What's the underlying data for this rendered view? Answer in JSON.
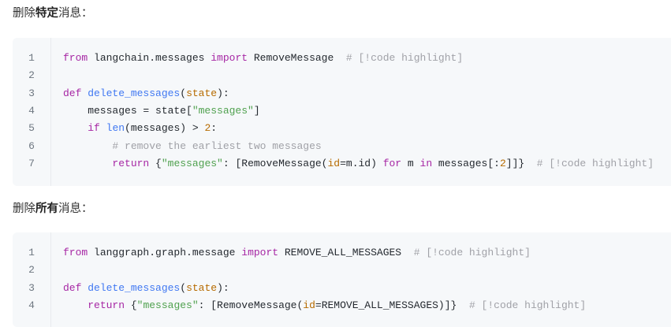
{
  "sections": [
    {
      "heading": {
        "prefix": "删除",
        "bold": "特定",
        "suffix": "消息："
      },
      "lines": [
        {
          "n": "1",
          "tokens": [
            {
              "t": "from",
              "c": "kw"
            },
            {
              "t": " langchain.messages ",
              "c": ""
            },
            {
              "t": "import",
              "c": "kw"
            },
            {
              "t": " RemoveMessage  ",
              "c": ""
            },
            {
              "t": "# [!code highlight]",
              "c": "cmt"
            }
          ]
        },
        {
          "n": "2",
          "tokens": []
        },
        {
          "n": "3",
          "tokens": [
            {
              "t": "def",
              "c": "kw"
            },
            {
              "t": " ",
              "c": ""
            },
            {
              "t": "delete_messages",
              "c": "fn"
            },
            {
              "t": "(",
              "c": ""
            },
            {
              "t": "state",
              "c": "param"
            },
            {
              "t": "):",
              "c": ""
            }
          ]
        },
        {
          "n": "4",
          "tokens": [
            {
              "t": "    messages = state[",
              "c": ""
            },
            {
              "t": "\"messages\"",
              "c": "str"
            },
            {
              "t": "]",
              "c": ""
            }
          ]
        },
        {
          "n": "5",
          "tokens": [
            {
              "t": "    ",
              "c": ""
            },
            {
              "t": "if",
              "c": "kw"
            },
            {
              "t": " ",
              "c": ""
            },
            {
              "t": "len",
              "c": "fn"
            },
            {
              "t": "(messages) > ",
              "c": ""
            },
            {
              "t": "2",
              "c": "num"
            },
            {
              "t": ":",
              "c": ""
            }
          ]
        },
        {
          "n": "6",
          "tokens": [
            {
              "t": "        ",
              "c": ""
            },
            {
              "t": "# remove the earliest two messages",
              "c": "cmt"
            }
          ]
        },
        {
          "n": "7",
          "tokens": [
            {
              "t": "        ",
              "c": ""
            },
            {
              "t": "return",
              "c": "kw"
            },
            {
              "t": " {",
              "c": ""
            },
            {
              "t": "\"messages\"",
              "c": "str"
            },
            {
              "t": ": [RemoveMessage(",
              "c": ""
            },
            {
              "t": "id",
              "c": "param"
            },
            {
              "t": "=m.id) ",
              "c": ""
            },
            {
              "t": "for",
              "c": "kw"
            },
            {
              "t": " m ",
              "c": ""
            },
            {
              "t": "in",
              "c": "kw"
            },
            {
              "t": " messages[:",
              "c": ""
            },
            {
              "t": "2",
              "c": "num"
            },
            {
              "t": "]]}  ",
              "c": ""
            },
            {
              "t": "# [!code highlight]",
              "c": "cmt"
            }
          ]
        }
      ]
    },
    {
      "heading": {
        "prefix": "删除",
        "bold": "所有",
        "suffix": "消息："
      },
      "lines": [
        {
          "n": "1",
          "tokens": [
            {
              "t": "from",
              "c": "kw"
            },
            {
              "t": " langgraph.graph.message ",
              "c": ""
            },
            {
              "t": "import",
              "c": "kw"
            },
            {
              "t": " REMOVE_ALL_MESSAGES  ",
              "c": ""
            },
            {
              "t": "# [!code highlight]",
              "c": "cmt"
            }
          ]
        },
        {
          "n": "2",
          "tokens": []
        },
        {
          "n": "3",
          "tokens": [
            {
              "t": "def",
              "c": "kw"
            },
            {
              "t": " ",
              "c": ""
            },
            {
              "t": "delete_messages",
              "c": "fn"
            },
            {
              "t": "(",
              "c": ""
            },
            {
              "t": "state",
              "c": "param"
            },
            {
              "t": "):",
              "c": ""
            }
          ]
        },
        {
          "n": "4",
          "tokens": [
            {
              "t": "    ",
              "c": ""
            },
            {
              "t": "return",
              "c": "kw"
            },
            {
              "t": " {",
              "c": ""
            },
            {
              "t": "\"messages\"",
              "c": "str"
            },
            {
              "t": ": [RemoveMessage(",
              "c": ""
            },
            {
              "t": "id",
              "c": "param"
            },
            {
              "t": "=REMOVE_ALL_MESSAGES)]}  ",
              "c": ""
            },
            {
              "t": "# [!code highlight]",
              "c": "cmt"
            }
          ]
        }
      ]
    }
  ]
}
